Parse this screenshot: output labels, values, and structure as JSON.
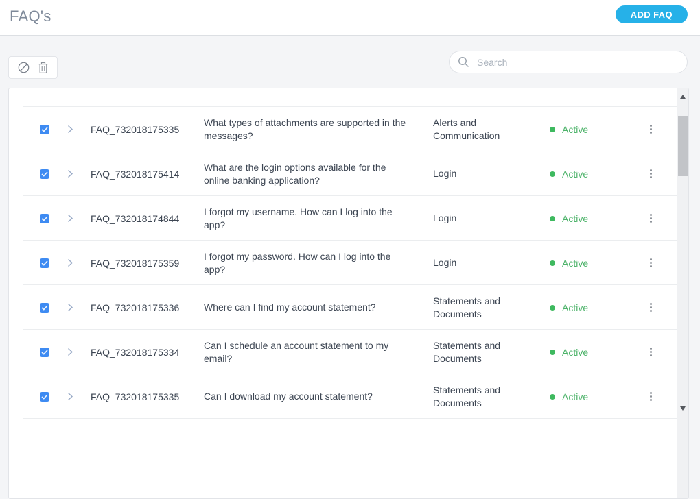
{
  "page": {
    "title": "FAQ's"
  },
  "header": {
    "add_button_label": "ADD FAQ"
  },
  "toolbar": {
    "search_placeholder": "Search",
    "icons": {
      "deactivate": "circle-slash-icon",
      "delete": "trash-icon",
      "search": "magnifier-icon"
    }
  },
  "colors": {
    "accent_blue": "#26b1e8",
    "checkbox_blue": "#3e8bf2",
    "active_green": "#4db36a",
    "title_gray": "#7e8999"
  },
  "table": {
    "row_icons": {
      "expand": "chevron-right-icon",
      "menu": "kebab-vertical-icon"
    },
    "rows": [
      {
        "checked": true,
        "id": "FAQ_732018175335",
        "question": "What types of attachments are supported in the messages?",
        "category": "Alerts and Communication",
        "status": "Active"
      },
      {
        "checked": true,
        "id": "FAQ_732018175414",
        "question": "What are the login options available for the online banking application?",
        "category": "Login",
        "status": "Active"
      },
      {
        "checked": true,
        "id": "FAQ_732018174844",
        "question": "I forgot my username. How can I log into the app?",
        "category": "Login",
        "status": "Active"
      },
      {
        "checked": true,
        "id": "FAQ_732018175359",
        "question": "I forgot my password. How can I log into the app?",
        "category": "Login",
        "status": "Active"
      },
      {
        "checked": true,
        "id": "FAQ_732018175336",
        "question": "Where can I find my account statement?",
        "category": "Statements and Documents",
        "status": "Active"
      },
      {
        "checked": true,
        "id": "FAQ_732018175334",
        "question": "Can I schedule an account statement to my email?",
        "category": "Statements and Documents",
        "status": "Active"
      },
      {
        "checked": true,
        "id": "FAQ_732018175335",
        "question": "Can I download my account statement?",
        "category": "Statements and Documents",
        "status": "Active"
      }
    ]
  }
}
